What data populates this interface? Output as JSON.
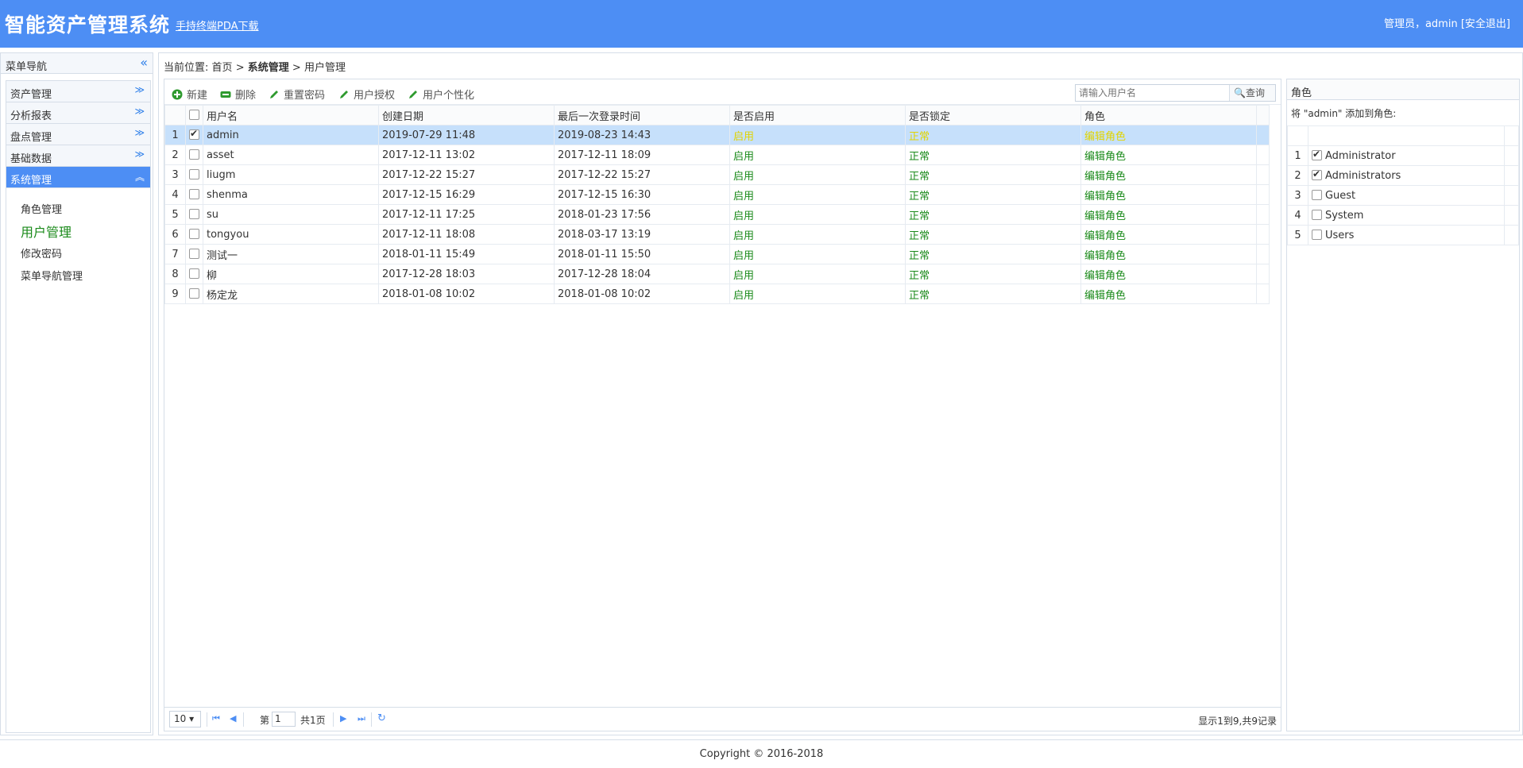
{
  "header": {
    "title": "智能资产管理系统",
    "pda_link": "手持终端PDA下载",
    "user_text": "管理员，admin",
    "logout": "[安全退出]"
  },
  "sidebar": {
    "title": "菜单导航",
    "collapse_icon": "double-chevron-left-icon",
    "sections": [
      {
        "label": "资产管理"
      },
      {
        "label": "分析报表"
      },
      {
        "label": "盘点管理"
      },
      {
        "label": "基础数据"
      },
      {
        "label": "系统管理"
      }
    ],
    "sub_items": [
      {
        "label": "角色管理"
      },
      {
        "label": "用户管理"
      },
      {
        "label": "修改密码"
      },
      {
        "label": "菜单导航管理"
      }
    ]
  },
  "breadcrumb": {
    "prefix": "当前位置:",
    "home": "首页",
    "sep": ">",
    "level1": "系统管理",
    "level2": "用户管理"
  },
  "toolbar": {
    "new": "新建",
    "delete": "删除",
    "reset_password": "重置密码",
    "authorize": "用户授权",
    "personalize": "用户个性化",
    "search_placeholder": "请输入用户名",
    "search_button": "查询"
  },
  "grid": {
    "columns": [
      "用户名",
      "创建日期",
      "最后一次登录时间",
      "是否启用",
      "是否锁定",
      "角色"
    ],
    "rows": [
      {
        "n": "1",
        "checked": true,
        "user": "admin",
        "created": "2019-07-29 11:48",
        "last": "2019-08-23 14:43",
        "enabled": "启用",
        "locked": "正常",
        "role": "编辑角色"
      },
      {
        "n": "2",
        "checked": false,
        "user": "asset",
        "created": "2017-12-11 13:02",
        "last": "2017-12-11 18:09",
        "enabled": "启用",
        "locked": "正常",
        "role": "编辑角色"
      },
      {
        "n": "3",
        "checked": false,
        "user": "liugm",
        "created": "2017-12-22 15:27",
        "last": "2017-12-22 15:27",
        "enabled": "启用",
        "locked": "正常",
        "role": "编辑角色"
      },
      {
        "n": "4",
        "checked": false,
        "user": "shenma",
        "created": "2017-12-15 16:29",
        "last": "2017-12-15 16:30",
        "enabled": "启用",
        "locked": "正常",
        "role": "编辑角色"
      },
      {
        "n": "5",
        "checked": false,
        "user": "su",
        "created": "2017-12-11 17:25",
        "last": "2018-01-23 17:56",
        "enabled": "启用",
        "locked": "正常",
        "role": "编辑角色"
      },
      {
        "n": "6",
        "checked": false,
        "user": "tongyou",
        "created": "2017-12-11 18:08",
        "last": "2018-03-17 13:19",
        "enabled": "启用",
        "locked": "正常",
        "role": "编辑角色"
      },
      {
        "n": "7",
        "checked": false,
        "user": "测试一",
        "created": "2018-01-11 15:49",
        "last": "2018-01-11 15:50",
        "enabled": "启用",
        "locked": "正常",
        "role": "编辑角色"
      },
      {
        "n": "8",
        "checked": false,
        "user": "柳",
        "created": "2017-12-28 18:03",
        "last": "2017-12-28 18:04",
        "enabled": "启用",
        "locked": "正常",
        "role": "编辑角色"
      },
      {
        "n": "9",
        "checked": false,
        "user": "杨定龙",
        "created": "2018-01-08 10:02",
        "last": "2018-01-08 10:02",
        "enabled": "启用",
        "locked": "正常",
        "role": "编辑角色"
      }
    ]
  },
  "pager": {
    "page_size": "10",
    "page_prefix": "第",
    "page_number": "1",
    "page_total": "共1页",
    "info": "显示1到9,共9记录"
  },
  "roles_panel": {
    "title": "角色",
    "description": "将 \"admin\" 添加到角色:",
    "rows": [
      {
        "n": "1",
        "checked": true,
        "name": "Administrator"
      },
      {
        "n": "2",
        "checked": true,
        "name": "Administrators"
      },
      {
        "n": "3",
        "checked": false,
        "name": "Guest"
      },
      {
        "n": "4",
        "checked": false,
        "name": "System"
      },
      {
        "n": "5",
        "checked": false,
        "name": "Users"
      }
    ]
  },
  "footer": {
    "copyright": "Copyright © 2016-2018"
  },
  "colors": {
    "header_bg": "#4d8ef4",
    "selected_row": "#c6e0fb",
    "status_green": "#1a8a1a"
  }
}
